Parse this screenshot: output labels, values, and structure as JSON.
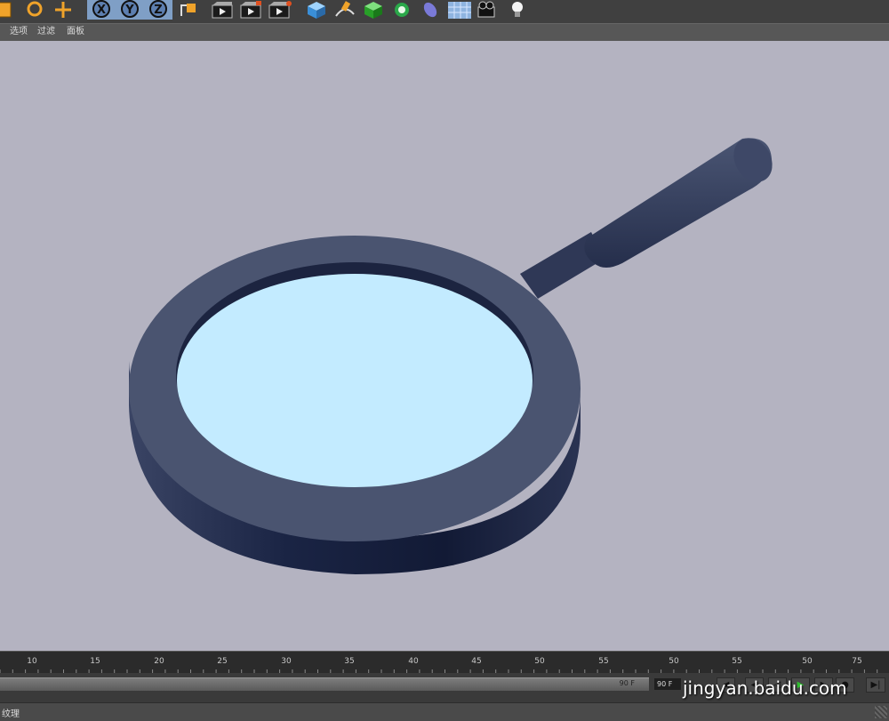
{
  "toolbar": {
    "icons": [
      "scale-tool-icon",
      "rotate-tool-icon",
      "move-tool-icon",
      "x-axis-lock-icon",
      "y-axis-lock-icon",
      "z-axis-lock-icon",
      "coordinate-system-icon",
      "render-view-icon",
      "render-picture-queue-icon",
      "render-settings-icon",
      "cube-primitive-icon",
      "spline-pen-icon",
      "generator-icon",
      "deformer-icon",
      "nurbs-icon",
      "floor-icon",
      "camera-icon",
      "light-icon"
    ],
    "axis_x": "X",
    "axis_y": "Y",
    "axis_z": "Z"
  },
  "menubar": {
    "items": [
      {
        "label": "选项"
      },
      {
        "label": "过滤"
      },
      {
        "label": "面板"
      }
    ]
  },
  "viewport": {
    "background": "#b4b3c1",
    "object": "magnifying-glass-model",
    "colors": {
      "frame": "#4a5470",
      "frame_dark": "#1a2340",
      "lens": "#c3ebff",
      "handle": "#3b4563"
    }
  },
  "timeline": {
    "ticks": [
      "10",
      "15",
      "20",
      "25",
      "30",
      "35",
      "40",
      "45",
      "50",
      "55",
      "50",
      "55",
      "50",
      "75"
    ],
    "rail_value": "90 F",
    "end_frame": "90 F",
    "buttons": [
      "go-to-start-icon",
      "prev-key-icon",
      "play-backward-icon",
      "play-forward-icon",
      "next-key-icon",
      "record-icon",
      "go-to-end-icon"
    ]
  },
  "watermark": "jingyan.baidu.com",
  "statusbar": {
    "text": "纹理"
  }
}
